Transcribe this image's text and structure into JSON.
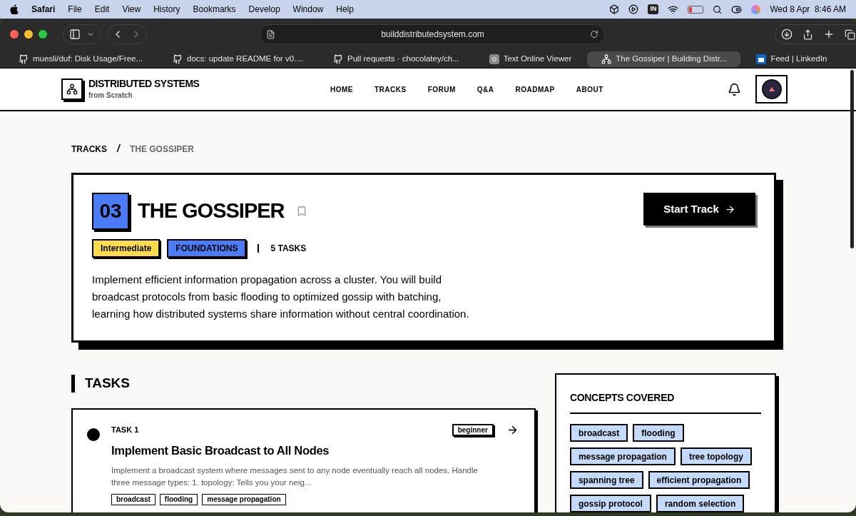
{
  "menu_bar": {
    "app": "Safari",
    "menus": [
      "File",
      "Edit",
      "View",
      "History",
      "Bookmarks",
      "Develop",
      "Window",
      "Help"
    ],
    "input_source": "IN",
    "clock": "Wed 8 Apr  8:46 AM"
  },
  "browser": {
    "address": "builddistributedsystem.com",
    "tabs": [
      {
        "title": "muesli/duf: Disk Usage/Free...",
        "kind": "github",
        "selected": false
      },
      {
        "title": "docs: update README for v0....",
        "kind": "github",
        "selected": false
      },
      {
        "title": "Pull requests · chocolatey/ch...",
        "kind": "github",
        "selected": false
      },
      {
        "title": "Text Online Viewer",
        "kind": "viewer",
        "selected": false
      },
      {
        "title": "The Gossiper | Building Distr...",
        "kind": "site",
        "selected": true
      },
      {
        "title": "Feed | LinkedIn",
        "kind": "linkedin",
        "selected": false
      }
    ]
  },
  "site_header": {
    "brand": "DISTRIBUTED SYSTEMS",
    "tagline": "from Scratch",
    "nav": [
      "HOME",
      "TRACKS",
      "FORUM",
      "Q&A",
      "ROADMAP",
      "ABOUT"
    ]
  },
  "breadcrumb": {
    "items": [
      "TRACKS",
      "THE GOSSIPER"
    ],
    "separator": "/"
  },
  "track": {
    "number": "03",
    "title": "THE GOSSIPER",
    "bookmarked": false,
    "badges": [
      {
        "label": "Intermediate",
        "color": "#fcdc4d"
      },
      {
        "label": "FOUNDATIONS",
        "color": "#4a7cf7"
      }
    ],
    "task_count": "5 TASKS",
    "description": "Implement efficient information propagation across a cluster. You will build broadcast protocols from basic flooding to optimized gossip with batching, learning how distributed systems share information without central coordination.",
    "start_button": "Start Track"
  },
  "tasks": {
    "heading": "TASKS",
    "items": [
      {
        "label": "TASK 1",
        "title": "Implement Basic Broadcast to All Nodes",
        "difficulty": "beginner",
        "completed": false,
        "description": "Implement a broadcast system where messages sent to any node eventually reach all nodes. Handle three message types: 1. topology: Tells you your neig...",
        "tags": [
          "broadcast",
          "flooding",
          "message propagation"
        ]
      }
    ]
  },
  "concepts": {
    "heading": "CONCEPTS COVERED",
    "tags": [
      "broadcast",
      "flooding",
      "message propagation",
      "tree topology",
      "spanning tree",
      "efficient propagation",
      "gossip protocol",
      "random selection"
    ]
  }
}
